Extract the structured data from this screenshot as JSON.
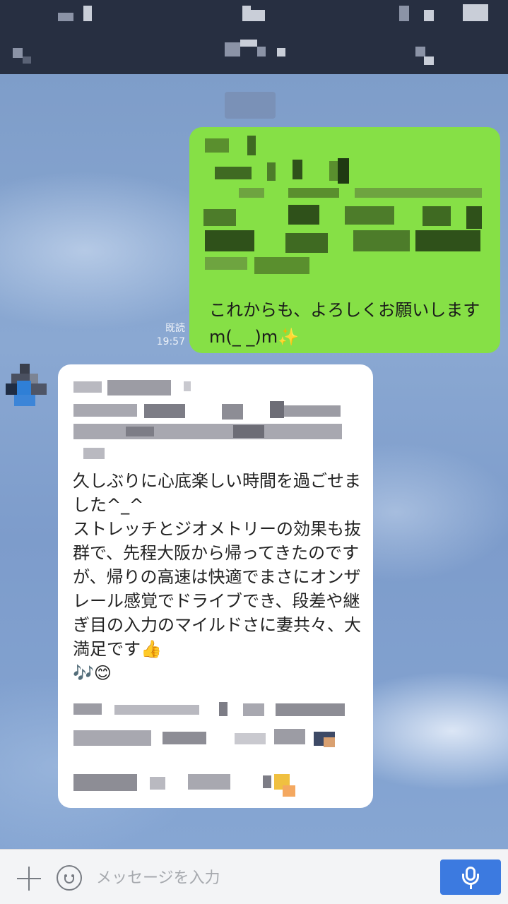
{
  "chat": {
    "my_message_visible_text": "これからも、よろしくお願いしますm(_ _)m✨",
    "read_label": "既読",
    "read_time": "19:57",
    "their_message_visible_text": "久しぶりに心底楽しい時間を過ごせました^_^\nストレッチとジオメトリーの効果も抜群で、先程大阪から帰ってきたのですが、帰りの高速は快適でまさにオンザレール感覚でドライブでき、段差や継ぎ目の入力のマイルドさに妻共々、大満足です👍\n🎶😊"
  },
  "input_bar": {
    "placeholder": "メッセージを入力"
  },
  "icons": {
    "add": "plus-icon",
    "sticker": "emoji-icon",
    "voice": "microphone-icon"
  },
  "colors": {
    "header": "#272f41",
    "my_bubble": "#86e046",
    "their_bubble": "#ffffff",
    "mic_button": "#3c7ae0"
  }
}
